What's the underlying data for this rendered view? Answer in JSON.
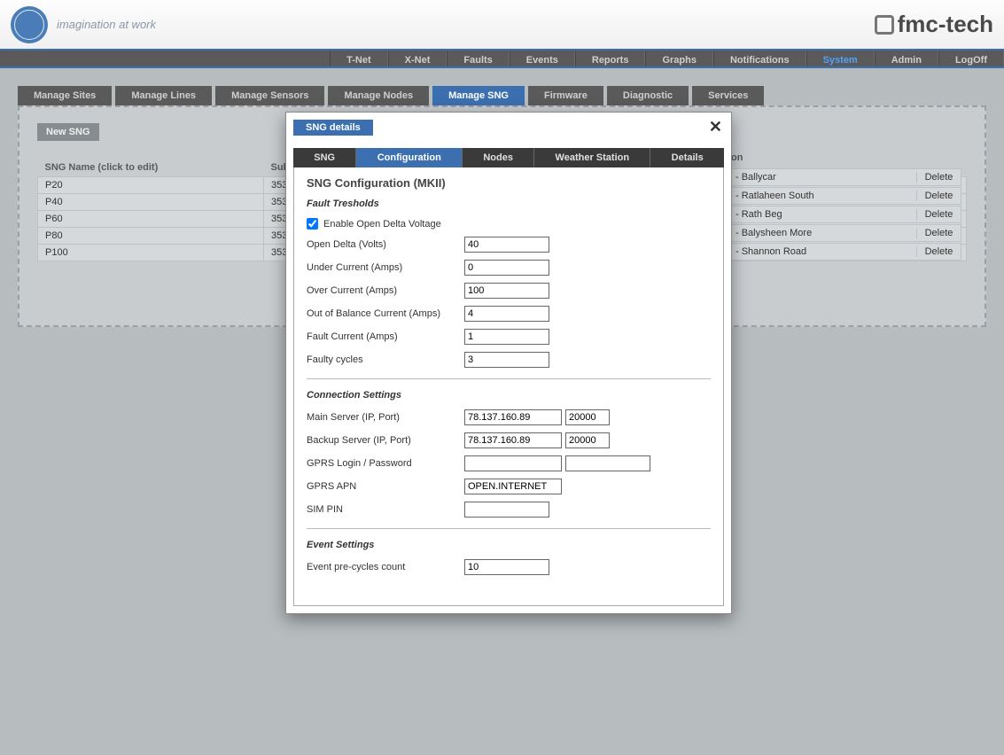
{
  "header": {
    "tagline": "imagination at work",
    "fmc": "fmc-tech"
  },
  "main_nav": [
    "T-Net",
    "X-Net",
    "Faults",
    "Events",
    "Reports",
    "Graphs",
    "Notifications",
    "System",
    "Admin",
    "LogOff"
  ],
  "main_nav_active": "System",
  "sub_nav": [
    "Manage Sites",
    "Manage Lines",
    "Manage Sensors",
    "Manage Nodes",
    "Manage SNG",
    "Firmware",
    "Diagnostic",
    "Services"
  ],
  "sub_nav_active": "Manage SNG",
  "new_button": "New SNG",
  "table": {
    "headers": {
      "name": "SNG Name (click to edit)",
      "sub": "Sub",
      "loc": "on",
      "del": "Delete"
    },
    "rows": [
      {
        "name": "P20",
        "sub": "353"
      },
      {
        "name": "P40",
        "sub": "353"
      },
      {
        "name": "P60",
        "sub": "353"
      },
      {
        "name": "P80",
        "sub": "353"
      },
      {
        "name": "P100",
        "sub": "353"
      }
    ],
    "right_rows": [
      {
        "loc": "- Ballycar",
        "del": "Delete"
      },
      {
        "loc": "- Ratlaheen South",
        "del": "Delete"
      },
      {
        "loc": "- Rath Beg",
        "del": "Delete"
      },
      {
        "loc": "- Balysheen More",
        "del": "Delete"
      },
      {
        "loc": "- Shannon Road",
        "del": "Delete"
      }
    ]
  },
  "modal": {
    "title": "SNG details",
    "tabs": [
      "SNG",
      "Configuration",
      "Nodes",
      "Weather Station",
      "Details"
    ],
    "active_tab": "Configuration",
    "heading": "SNG Configuration (MKII)",
    "sections": {
      "fault": {
        "title": "Fault Tresholds",
        "enable_label": "Enable Open Delta Voltage",
        "enable_checked": true,
        "fields": [
          {
            "label": "Open Delta (Volts)",
            "value": "40"
          },
          {
            "label": "Under Current (Amps)",
            "value": "0"
          },
          {
            "label": "Over Current (Amps)",
            "value": "100"
          },
          {
            "label": "Out of Balance Current (Amps)",
            "value": "4"
          },
          {
            "label": "Fault Current (Amps)",
            "value": "1"
          },
          {
            "label": "Faulty cycles",
            "value": "3"
          }
        ]
      },
      "conn": {
        "title": "Connection Settings",
        "main_label": "Main Server (IP, Port)",
        "main_ip": "78.137.160.89",
        "main_port": "20000",
        "backup_label": "Backup Server (IP, Port)",
        "backup_ip": "78.137.160.89",
        "backup_port": "20000",
        "gprs_label": "GPRS Login / Password",
        "gprs_login": "",
        "gprs_pass": "",
        "apn_label": "GPRS APN",
        "apn": "OPEN.INTERNET",
        "sim_label": "SIM PIN",
        "sim": ""
      },
      "event": {
        "title": "Event Settings",
        "pre_label": "Event pre-cycles count",
        "pre": "10"
      }
    }
  }
}
